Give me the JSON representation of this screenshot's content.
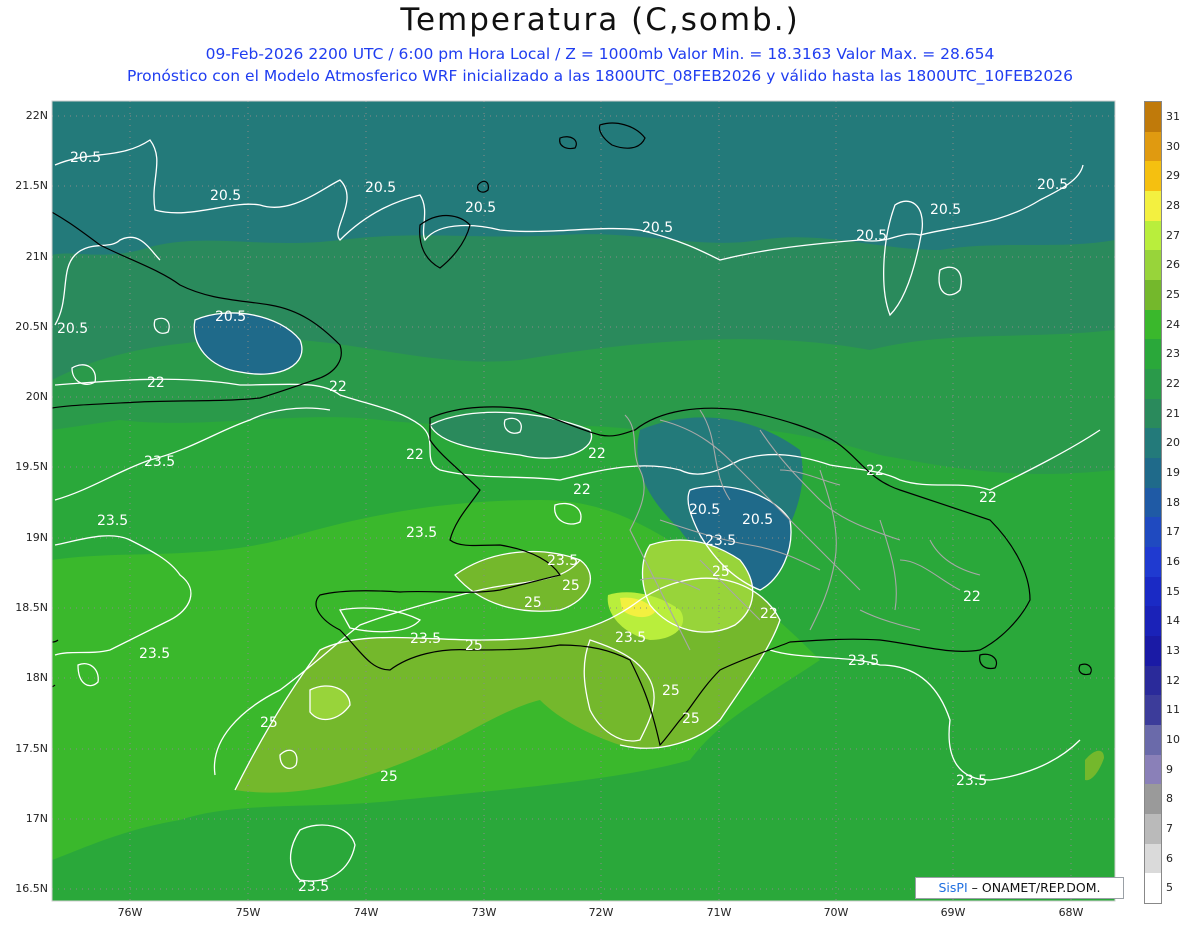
{
  "header": {
    "title": "Temperatura (C,somb.)",
    "line1": "09-Feb-2026  2200 UTC / 6:00 pm Hora Local / Z = 1000mb    Valor Min. = 18.3163  Valor Max. = 28.654",
    "line2": "Pronóstico con el Modelo Atmosferico WRF inicializado a las 1800UTC_08FEB2026 y válido hasta las  1800UTC_10FEB2026"
  },
  "axes": {
    "lat_labels": [
      "22N",
      "21.5N",
      "21N",
      "20.5N",
      "20N",
      "19.5N",
      "19N",
      "18.5N",
      "18N",
      "17.5N",
      "17N",
      "16.5N"
    ],
    "lon_labels": [
      "76W",
      "75W",
      "74W",
      "73W",
      "72W",
      "71W",
      "70W",
      "69W",
      "68W"
    ]
  },
  "contour_labels": [
    "20.5",
    "22",
    "23.5",
    "25"
  ],
  "colorbar": {
    "labels": [
      "31",
      "30",
      "29",
      "28",
      "27",
      "26",
      "25",
      "24",
      "23",
      "22",
      "21",
      "20",
      "19",
      "18",
      "17",
      "16",
      "15",
      "14",
      "13",
      "12",
      "11",
      "10",
      "9",
      "8",
      "7",
      "6",
      "5"
    ],
    "colors": [
      "#c07a0a",
      "#e09a10",
      "#f5c010",
      "#f3f040",
      "#b9ee3c",
      "#98d43a",
      "#74b82c",
      "#3ab82c",
      "#2aa83a",
      "#2a9a4a",
      "#2a8a5c",
      "#237a7a",
      "#1f6a8a",
      "#1f5aa5",
      "#1f4ac0",
      "#1f3ad0",
      "#1a2ac5",
      "#1a22b8",
      "#1a1aa5",
      "#2a2a9a",
      "#3c3c9a",
      "#6a6aaa",
      "#8a80b8",
      "#9a9a9a",
      "#bababa",
      "#dadada",
      "#ffffff"
    ]
  },
  "credit": {
    "brand": "SisPI",
    "org": " – ONAMET/REP.DOM."
  },
  "colors": {
    "header_blue": "#1f3df0",
    "contour": "#ffffff",
    "coast": "#000000",
    "provinces": "#a0a0a0"
  }
}
